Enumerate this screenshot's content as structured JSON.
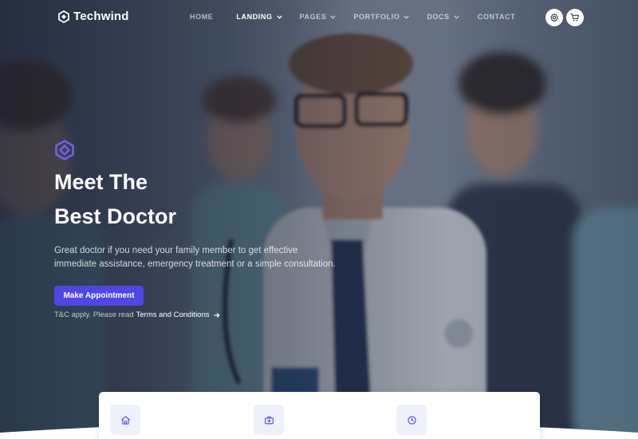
{
  "brand": {
    "name": "Techwind",
    "accent": "#4f46e5"
  },
  "nav": {
    "items": [
      {
        "label": "HOME",
        "has_dropdown": false,
        "active": false
      },
      {
        "label": "LANDING",
        "has_dropdown": true,
        "active": true
      },
      {
        "label": "PAGES",
        "has_dropdown": true,
        "active": false
      },
      {
        "label": "PORTFOLIO",
        "has_dropdown": true,
        "active": false
      },
      {
        "label": "DOCS",
        "has_dropdown": true,
        "active": false
      },
      {
        "label": "CONTACT",
        "has_dropdown": false,
        "active": false
      }
    ],
    "buttons": [
      "settings-icon",
      "cart-icon"
    ]
  },
  "hero": {
    "logo_icon": "techwind-logo-icon",
    "title_line1": "Meet The",
    "title_line2": "Best Doctor",
    "description": "Great doctor if you need your family member to get effective immediate assistance, emergency treatment or a simple consultation.",
    "cta_label": "Make Appointment",
    "terms_prefix": "T&C apply. Please read",
    "terms_link": "Terms and Conditions"
  },
  "features": {
    "icons": [
      "home-icon",
      "medical-kit-icon",
      "clock-icon"
    ]
  }
}
